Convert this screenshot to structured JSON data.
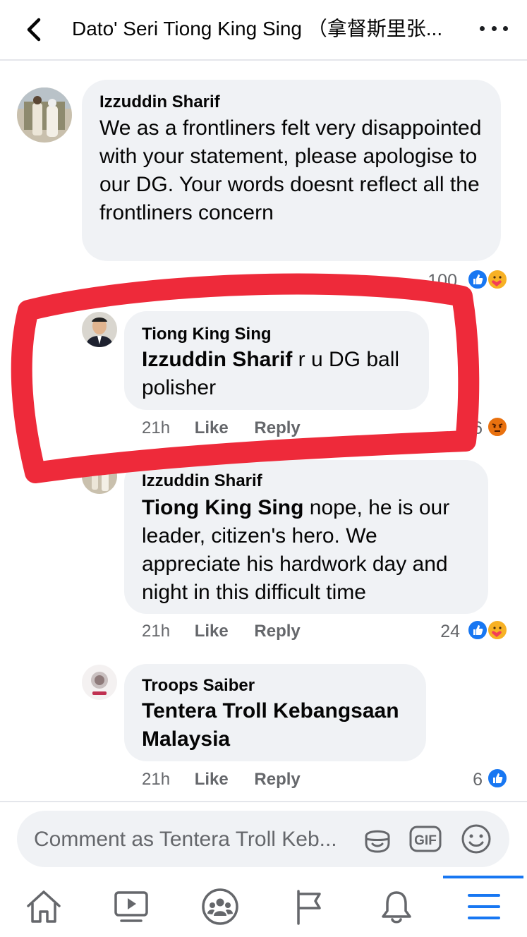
{
  "header": {
    "title": "Dato' Seri Tiong King Sing （拿督斯里张...",
    "back_icon": "chevron-left-icon",
    "more_icon": "ellipsis-icon"
  },
  "comments": [
    {
      "author": "Izzuddin Sharif",
      "mention": "",
      "text": "We as a frontliners felt very disappointed with your statement, please apologise to our DG. Your words doesnt reflect all the frontliners concern",
      "reaction_count": "100",
      "reactions": [
        "like",
        "care"
      ]
    },
    {
      "author": "Tiong King Sing",
      "mention": "Izzuddin Sharif",
      "text": " r u DG ball polisher",
      "time": "21h",
      "like_label": "Like",
      "reply_label": "Reply",
      "reaction_count": "6",
      "reactions": [
        "angry"
      ]
    },
    {
      "author": "Izzuddin Sharif",
      "mention": "Tiong King Sing",
      "text": " nope, he is our leader, citizen's hero. We appreciate his hardwork day and night in this difficult time",
      "time": "21h",
      "like_label": "Like",
      "reply_label": "Reply",
      "reaction_count": "24",
      "reactions": [
        "like",
        "care"
      ]
    },
    {
      "author": "Troops Saiber",
      "mention": "",
      "text": "Tentera Troll Kebangsaan Malaysia",
      "time": "21h",
      "like_label": "Like",
      "reply_label": "Reply",
      "reaction_count": "6",
      "reactions": [
        "like"
      ]
    }
  ],
  "composer": {
    "placeholder": "Comment as Tentera Troll Keb...",
    "icons": [
      "sticker-icon",
      "gif-icon",
      "emoji-icon"
    ],
    "gif_label": "GIF"
  },
  "tabbar": {
    "items": [
      "home-icon",
      "watch-icon",
      "groups-icon",
      "pages-icon",
      "notifications-icon",
      "menu-icon"
    ],
    "active": "menu-icon"
  },
  "colors": {
    "accent": "#1877f2",
    "bubble": "#f0f2f5",
    "annotation": "#ee2a3a",
    "meta_text": "#65676b"
  }
}
